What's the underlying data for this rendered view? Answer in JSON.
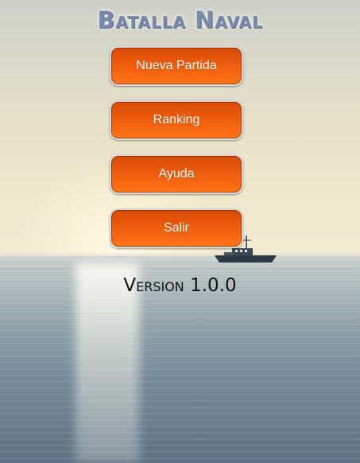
{
  "game": {
    "title": "Batalla Naval",
    "version_text": "Version 1.0.0"
  },
  "menu": {
    "items": [
      {
        "label": "Nueva Partida"
      },
      {
        "label": "Ranking"
      },
      {
        "label": "Ayuda"
      },
      {
        "label": "Salir"
      }
    ]
  },
  "theme": {
    "button_color": "#f0600f",
    "button_border": "#d9d9d9",
    "title_color": "#7a8ba8",
    "text_color": "#111111"
  }
}
